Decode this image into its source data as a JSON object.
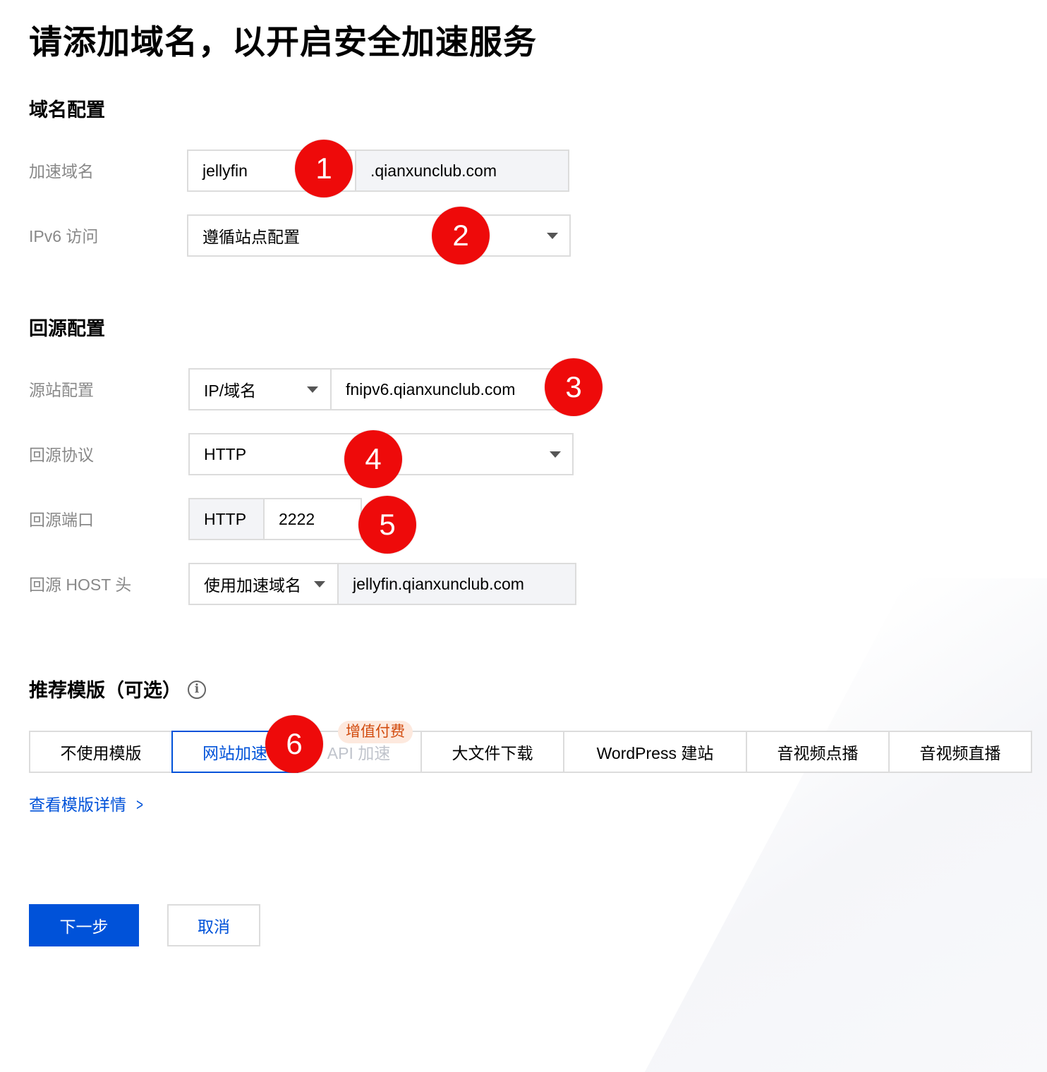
{
  "page_title": "请添加域名，以开启安全加速服务",
  "domain_config": {
    "section_title": "域名配置",
    "accel_domain_label": "加速域名",
    "accel_domain_value": "jellyfin",
    "accel_domain_suffix": ".qianxunclub.com",
    "ipv6_label": "IPv6 访问",
    "ipv6_value": "遵循站点配置"
  },
  "origin_config": {
    "section_title": "回源配置",
    "origin_site_label": "源站配置",
    "origin_type": "IP/域名",
    "origin_address": "fnipv6.qianxunclub.com",
    "origin_protocol_label": "回源协议",
    "origin_protocol_value": "HTTP",
    "origin_port_label": "回源端口",
    "origin_port_prefix": "HTTP",
    "origin_port_value": "2222",
    "origin_host_label": "回源 HOST 头",
    "origin_host_mode": "使用加速域名",
    "origin_host_value": "jellyfin.qianxunclub.com"
  },
  "templates": {
    "section_title": "推荐模版（可选）",
    "tabs": [
      {
        "label": "不使用模版"
      },
      {
        "label": "网站加速"
      },
      {
        "label": "API 加速"
      },
      {
        "label": "大文件下载"
      },
      {
        "label": "WordPress 建站"
      },
      {
        "label": "音视频点播"
      },
      {
        "label": "音视频直播"
      }
    ],
    "selected": "网站加速",
    "paid_tag": "增值付费",
    "details_link": "查看模版详情"
  },
  "badges": [
    "1",
    "2",
    "3",
    "4",
    "5",
    "6"
  ],
  "buttons": {
    "next": "下一步",
    "cancel": "取消"
  },
  "colors": {
    "accent": "#0052d9",
    "badge": "#ee0a0a",
    "label": "#888888",
    "border": "#dcdcdc"
  }
}
